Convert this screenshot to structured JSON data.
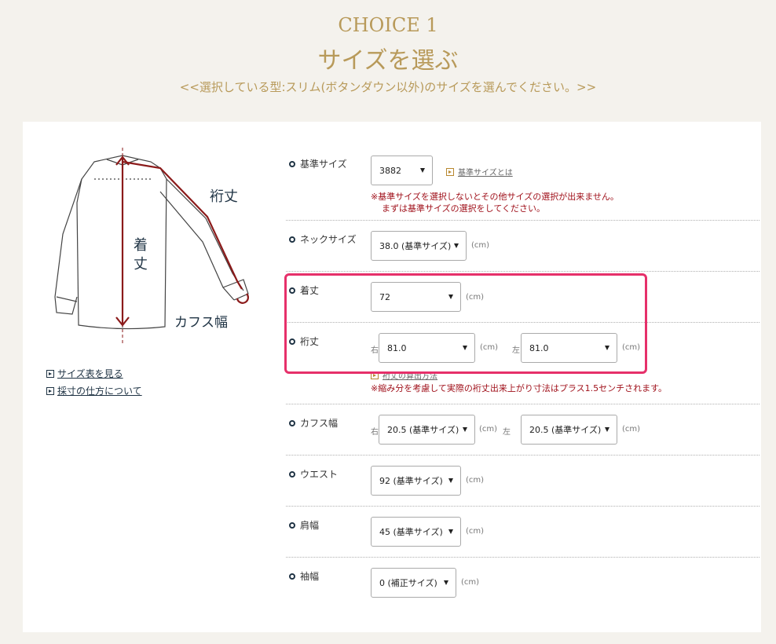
{
  "header": {
    "choice": "CHOICE 1",
    "title": "サイズを選ぶ",
    "subtitle": "<<選択している型:スリム(ボタンダウン以外)のサイズを選んでください。>>"
  },
  "illustration": {
    "label_sleeve": "裄丈",
    "label_length_1": "着",
    "label_length_2": "丈",
    "label_cuff": "カフス幅"
  },
  "side_links": {
    "size_chart": "サイズ表を見る",
    "measure": "採寸の仕方について"
  },
  "base_size": {
    "label": "基準サイズ",
    "value": "3882",
    "link": "基準サイズとは",
    "note_1": "※基準サイズを選択しないとその他サイズの選択が出来ません。",
    "note_2": "まずは基準サイズの選択をしてください。"
  },
  "neck": {
    "label": "ネックサイズ",
    "value": "38.0 (基準サイズ)",
    "unit": "(cm)"
  },
  "length": {
    "label": "着丈",
    "value": "72",
    "unit": "(cm)"
  },
  "sleeve": {
    "label": "裄丈",
    "right_label": "右",
    "right_value": "81.0",
    "left_label": "左",
    "left_value": "81.0",
    "unit": "(cm)",
    "link": "裄丈の算出方法",
    "note": "※縮み分を考慮して実際の裄丈出来上がり寸法はプラス1.5センチされます。"
  },
  "cuff": {
    "label": "カフス幅",
    "right_label": "右",
    "right_value": "20.5 (基準サイズ)",
    "left_label": "左",
    "left_value": "20.5 (基準サイズ)",
    "unit": "(cm)"
  },
  "waist": {
    "label": "ウエスト",
    "value": "92 (基準サイズ)",
    "unit": "(cm)"
  },
  "shoulder": {
    "label": "肩幅",
    "value": "45 (基準サイズ)",
    "unit": "(cm)"
  },
  "sleeve_width": {
    "label": "袖幅",
    "value": "0 (補正サイズ)",
    "unit": "(cm)"
  },
  "colors": {
    "gold": "#b89a5a",
    "navy": "#1f3344",
    "red": "#a0111b",
    "highlight": "#e6306a",
    "shirt_line": "#8b1a1a"
  }
}
